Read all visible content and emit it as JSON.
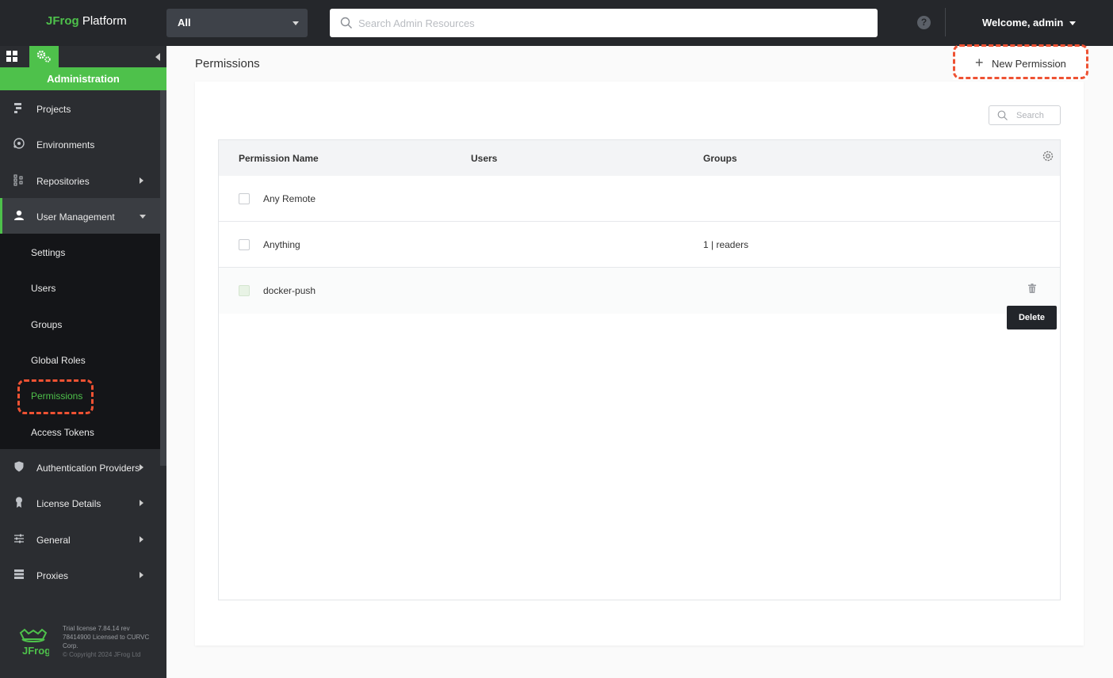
{
  "topbar": {
    "logo_brand": "JFrog",
    "logo_product": "Platform",
    "scope_selected": "All",
    "search_placeholder": "Search Admin Resources",
    "help_glyph": "?",
    "welcome": "Welcome, admin"
  },
  "sidebar": {
    "section_title": "Administration",
    "items": [
      {
        "label": "Projects",
        "icon": "projects-icon"
      },
      {
        "label": "Environments",
        "icon": "environments-icon"
      },
      {
        "label": "Repositories",
        "icon": "repositories-icon"
      },
      {
        "label": "User Management",
        "icon": "user-icon"
      },
      {
        "label": "Authentication Providers",
        "icon": "shield-icon"
      },
      {
        "label": "License Details",
        "icon": "badge-icon"
      },
      {
        "label": "General",
        "icon": "sliders-icon"
      },
      {
        "label": "Proxies",
        "icon": "server-icon"
      }
    ],
    "sub_items": [
      "Settings",
      "Users",
      "Groups",
      "Global Roles",
      "Permissions",
      "Access Tokens"
    ],
    "current_sub_item": "Permissions",
    "license_line1": "Trial license 7.84.14 rev",
    "license_line2": "78414900 Licensed to CURVC",
    "license_line3": "Corp.",
    "copyright": "© Copyright 2024 JFrog Ltd",
    "footer_logo_text": "JFrog"
  },
  "main": {
    "page_title": "Permissions",
    "new_button_label": "New Permission",
    "table_search_placeholder": "Search",
    "columns": [
      "Permission Name",
      "Users",
      "Groups"
    ],
    "rows": [
      {
        "name": "Any Remote",
        "users": "",
        "groups": ""
      },
      {
        "name": "Anything",
        "users": "",
        "groups": "1 | readers"
      },
      {
        "name": "docker-push",
        "users": "",
        "groups": ""
      }
    ],
    "tooltip": "Delete"
  },
  "colors": {
    "accent": "#4ec14b",
    "highlight": "#ee5233",
    "topbar": "#25272b",
    "sidebar": "#2b2d31"
  }
}
